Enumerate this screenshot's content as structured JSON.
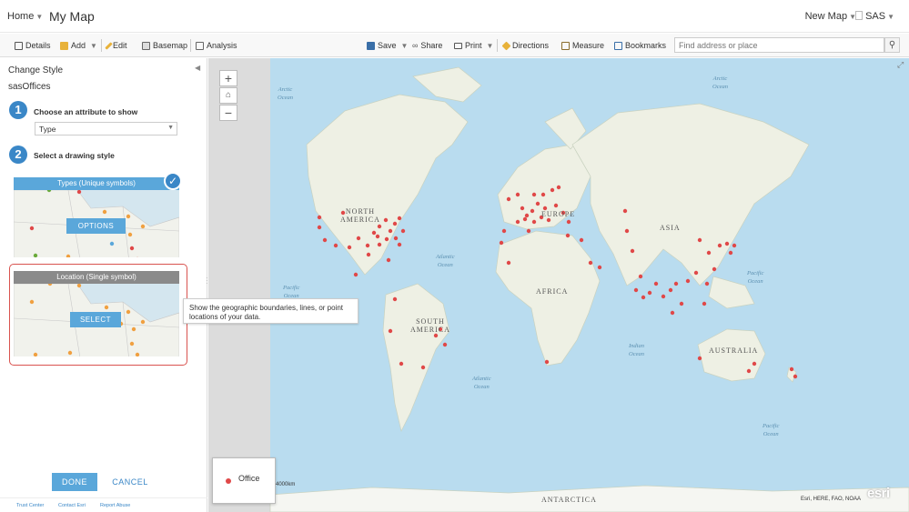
{
  "header": {
    "home_label": "Home",
    "map_title": "My Map",
    "new_map_label": "New Map",
    "user_label": "SAS"
  },
  "toolbar": {
    "details": "Details",
    "add": "Add",
    "edit": "Edit",
    "basemap": "Basemap",
    "analysis": "Analysis",
    "save": "Save",
    "share": "Share",
    "print": "Print",
    "directions": "Directions",
    "measure": "Measure",
    "bookmarks": "Bookmarks",
    "search_placeholder": "Find address or place"
  },
  "panel": {
    "title": "Change Style",
    "layer_name": "sasOffices",
    "step1_number": "1",
    "step1_label": "Choose an attribute to show",
    "attribute_value": "Type",
    "step2_number": "2",
    "step2_label": "Select a drawing style",
    "card_types_title": "Types (Unique symbols)",
    "card_types_button": "OPTIONS",
    "card_location_title": "Location (Single symbol)",
    "card_location_button": "SELECT",
    "tooltip": "Show the geographic boundaries, lines, or point locations of your data.",
    "done_label": "DONE",
    "cancel_label": "CANCEL",
    "footer": {
      "trust_center": "Trust Center",
      "contact_esri": "Contact Esri",
      "report_abuse": "Report Abuse"
    }
  },
  "map": {
    "zoom_in": "+",
    "zoom_out": "−",
    "legend_label": "Office",
    "scale_label": "4000km",
    "attribution": "Esri, HERE, FAO, NOAA",
    "logo_text": "esri",
    "labels": {
      "arctic_left": "Arctic\nOcean",
      "arctic_right": "Arctic\nOcean",
      "north_america": "NORTH\nAMERICA",
      "south_america": "SOUTH\nAMERICA",
      "europe": "EUROPE",
      "asia": "ASIA",
      "africa": "AFRICA",
      "australia": "AUSTRALIA",
      "antarctica": "ANTARCTICA",
      "pacific_left": "Pacific\nOcean",
      "pacific_right": "Pacific\nOcean",
      "pacific_bottom": "Pacific\nOcean",
      "atlantic_north": "Atlantic\nOcean",
      "atlantic_south": "Atlantic\nOcean",
      "indian": "Indian\nOcean"
    },
    "colors": {
      "office_point": "#e04848",
      "water": "#b9dcef",
      "land": "#eef0e4",
      "accent": "#3a87c7"
    }
  }
}
